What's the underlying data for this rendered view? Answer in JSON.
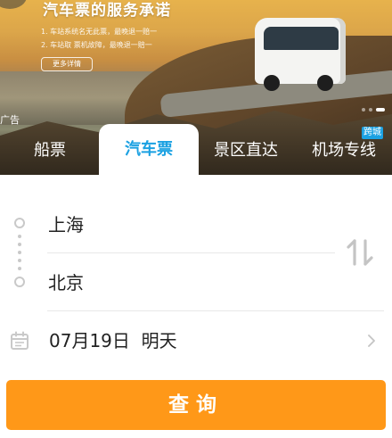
{
  "banner": {
    "title": "汽车票的服务承诺",
    "line1": "1. 车站系统名无此票，最晚退一赔一",
    "line2": "2. 车站取 票机故障，最晚退一赔一",
    "more_label": "更多详情",
    "ad_label": "广告"
  },
  "tabs": [
    {
      "label": "船票"
    },
    {
      "label": "汽车票"
    },
    {
      "label": "景区直达"
    },
    {
      "label": "机场专线",
      "badge": "跨城"
    }
  ],
  "form": {
    "from_city": "上海",
    "to_city": "北京",
    "date": "07月19日  明天"
  },
  "search_button": "查询",
  "colors": {
    "accent": "#1ba1e2",
    "button": "#ff9818"
  }
}
